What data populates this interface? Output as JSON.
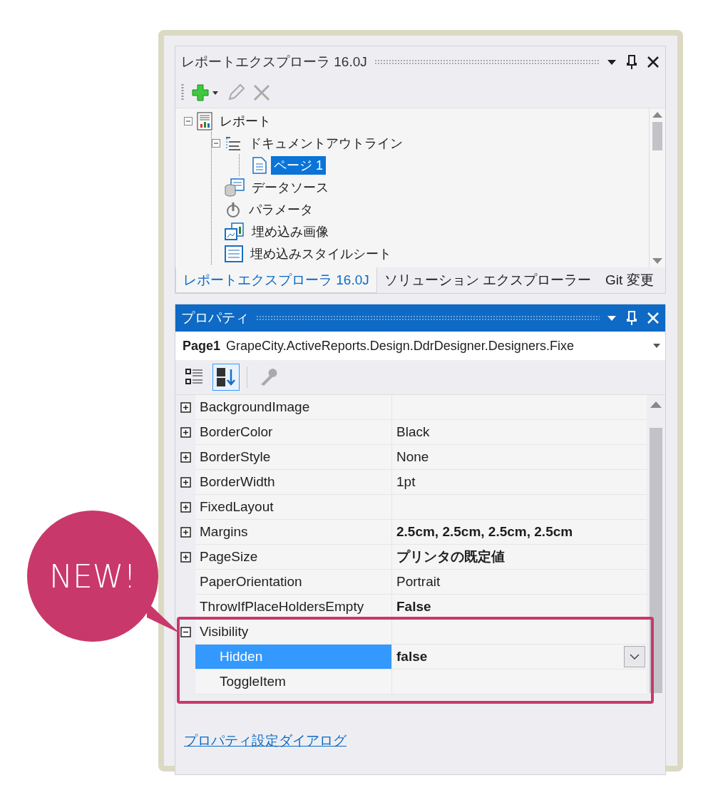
{
  "explorer": {
    "title": "レポートエクスプローラ 16.0J",
    "tree": [
      {
        "label": "レポート",
        "kind": "report",
        "selected": false,
        "expanded": true,
        "children": [
          {
            "label": "ドキュメントアウトライン",
            "kind": "outline",
            "selected": false,
            "expanded": true,
            "children": [
              {
                "label": "ページ 1",
                "kind": "page",
                "selected": true
              }
            ]
          },
          {
            "label": "データソース",
            "kind": "datasource",
            "selected": false
          },
          {
            "label": "パラメータ",
            "kind": "parameter",
            "selected": false
          },
          {
            "label": "埋め込み画像",
            "kind": "image",
            "selected": false
          },
          {
            "label": "埋め込みスタイルシート",
            "kind": "stylesheet",
            "selected": false
          }
        ]
      }
    ],
    "tabs": [
      {
        "label": "レポートエクスプローラ 16.0J",
        "selected": true
      },
      {
        "label": "ソリューション エクスプローラー",
        "selected": false
      },
      {
        "label": "Git 変更",
        "selected": false
      }
    ]
  },
  "properties": {
    "title": "プロパティ",
    "object_name": "Page1",
    "object_type": "GrapeCity.ActiveReports.Design.DdrDesigner.Designers.Fixe",
    "rows": [
      {
        "name": "BackgroundImage",
        "expanded": false,
        "selected": false
      },
      {
        "name": "BorderColor",
        "value": "Black",
        "expanded": false,
        "modified": false,
        "selected": false
      },
      {
        "name": "BorderStyle",
        "value": "None",
        "expanded": false,
        "modified": false,
        "selected": false
      },
      {
        "name": "BorderWidth",
        "value": "1pt",
        "expanded": false,
        "modified": false,
        "selected": false
      },
      {
        "name": "FixedLayout",
        "expanded": false,
        "selected": false
      },
      {
        "name": "Margins",
        "value": "2.5cm, 2.5cm, 2.5cm, 2.5cm",
        "expanded": false,
        "modified": true,
        "selected": false
      },
      {
        "name": "PageSize",
        "value": "プリンタの既定値",
        "expanded": false,
        "modified": true,
        "selected": false
      },
      {
        "name": "PaperOrientation",
        "value": "Portrait",
        "modified": false,
        "selected": false
      },
      {
        "name": "ThrowIfPlaceHoldersEmpty",
        "value": "False",
        "modified": true,
        "selected": false
      },
      {
        "name": "Visibility",
        "expanded": true,
        "selected": false,
        "children": [
          {
            "name": "Hidden",
            "value": "false",
            "modified": true,
            "selected": true,
            "dropdown": true
          },
          {
            "name": "ToggleItem",
            "selected": false
          }
        ]
      }
    ],
    "link": "プロパティ設定ダイアログ"
  },
  "annotation": {
    "label": "NEW!"
  }
}
